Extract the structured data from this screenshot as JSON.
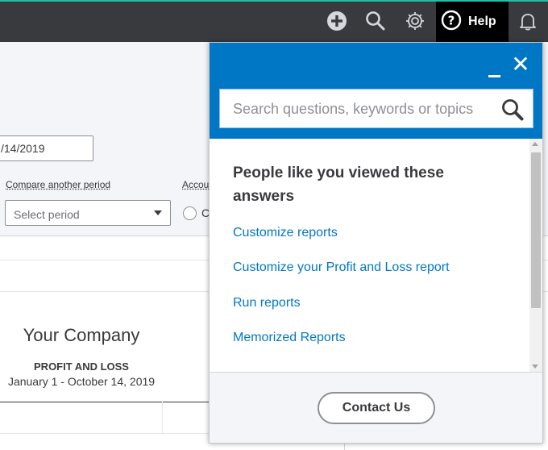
{
  "topbar": {
    "help_label": "Help",
    "icons": [
      "plus-icon",
      "search-icon",
      "gear-icon",
      "help-icon",
      "bell-icon"
    ],
    "accent_color": "#1ec0a8",
    "background_color": "#393a3d"
  },
  "filters": {
    "date_value": "/14/2019",
    "compare_label": "Compare another period",
    "compare_placeholder": "Select period",
    "accounting_label": "Accou",
    "accounting_option_partial": "C"
  },
  "report": {
    "company_name": "Your Company",
    "title": "PROFIT AND LOSS",
    "date_range": "January 1 - October 14, 2019"
  },
  "help_panel": {
    "header_color": "#0077c5",
    "search_placeholder": "Search questions, keywords or topics",
    "heading": "People like you viewed these answers",
    "links": [
      "Customize reports",
      "Customize your Profit and Loss report",
      "Run reports",
      "Memorized Reports"
    ],
    "contact_button": "Contact Us"
  }
}
